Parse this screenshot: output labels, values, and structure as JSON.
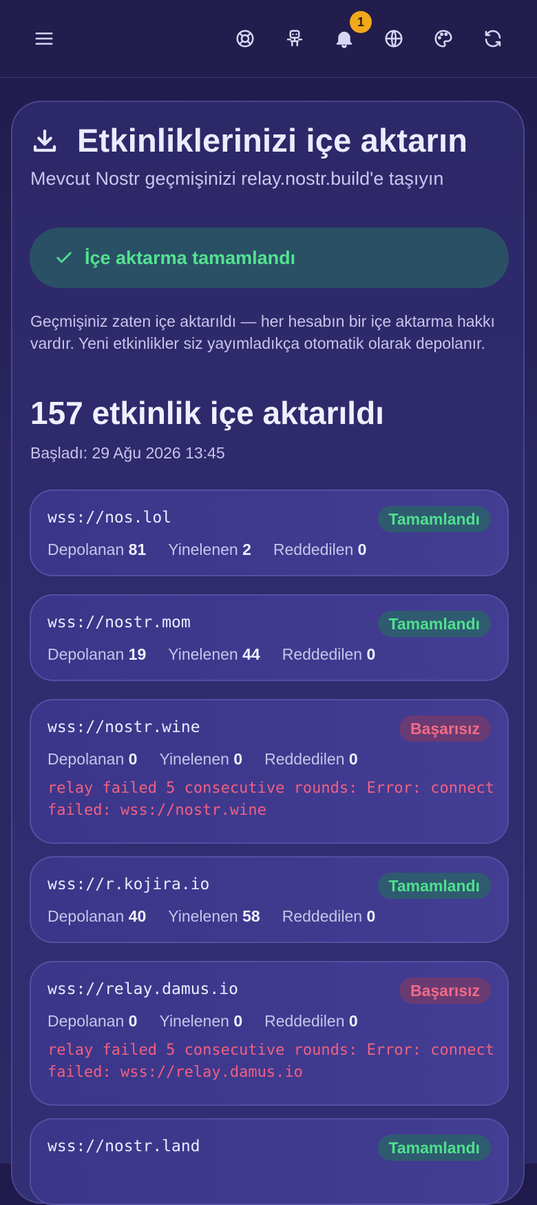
{
  "topbar": {
    "icons": [
      "menu-icon",
      "lifebuoy-icon",
      "robot-icon",
      "bell-icon",
      "globe-icon",
      "palette-icon",
      "refresh-icon"
    ],
    "notification_count": "1"
  },
  "import": {
    "title": "Etkinliklerinizi içe aktarın",
    "subtitle": "Mevcut Nostr geçmişinizi relay.nostr.build'e taşıyın",
    "success_label": "İçe aktarma tamamlandı",
    "note": "Geçmişiniz zaten içe aktarıldı — her hesabın bir içe aktarma hakkı vardır. Yeni etkinlikler siz yayımladıkça otomatik olarak depolanır.",
    "count_label": "157 etkinlik içe aktarıldı",
    "started_label": "Başladı: 29 Ağu 2026 13:45"
  },
  "labels": {
    "stored": "Depolanan",
    "duplicate": "Yinelenen",
    "rejected": "Reddedilen"
  },
  "relays": [
    {
      "url": "wss://nos.lol",
      "status": "Tamamlandı",
      "ok": true,
      "stored": "81",
      "duplicate": "2",
      "rejected": "0",
      "error": ""
    },
    {
      "url": "wss://nostr.mom",
      "status": "Tamamlandı",
      "ok": true,
      "stored": "19",
      "duplicate": "44",
      "rejected": "0",
      "error": ""
    },
    {
      "url": "wss://nostr.wine",
      "status": "Başarısız",
      "ok": false,
      "stored": "0",
      "duplicate": "0",
      "rejected": "0",
      "error": "relay failed 5 consecutive rounds: Error: connect failed: wss://nostr.wine"
    },
    {
      "url": "wss://r.kojira.io",
      "status": "Tamamlandı",
      "ok": true,
      "stored": "40",
      "duplicate": "58",
      "rejected": "0",
      "error": ""
    },
    {
      "url": "wss://relay.damus.io",
      "status": "Başarısız",
      "ok": false,
      "stored": "0",
      "duplicate": "0",
      "rejected": "0",
      "error": "relay failed 5 consecutive rounds: Error: connect failed: wss://relay.damus.io"
    },
    {
      "url": "wss://nostr.land",
      "status": "Tamamlandı",
      "ok": true,
      "stored": "",
      "duplicate": "",
      "rejected": "",
      "error": ""
    }
  ]
}
